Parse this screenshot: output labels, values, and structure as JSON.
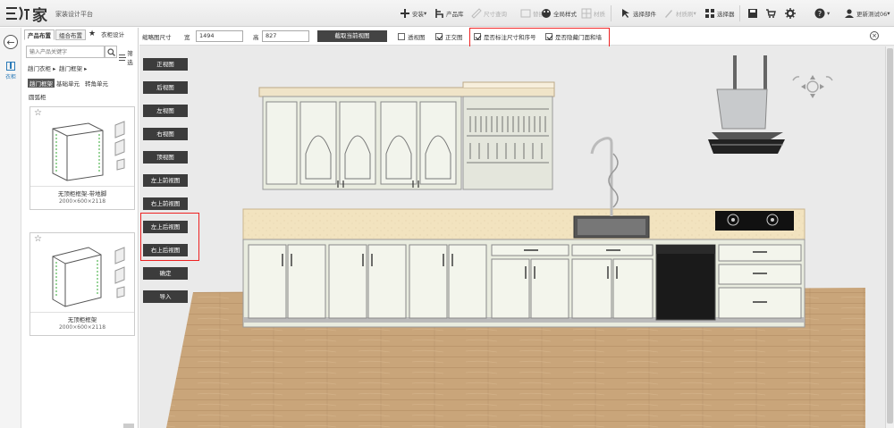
{
  "app": {
    "logo_text": "家",
    "platform_name": "家装设计平台"
  },
  "toolbar": {
    "install": "安装",
    "product_lib": "产品库",
    "size_query": "尺寸查询",
    "replace": "替换",
    "global_style": "全局样式",
    "material": "材质",
    "select_parts": "选择部件",
    "material_brush": "材质刷",
    "selector": "选择器",
    "user": "更新测试06"
  },
  "left": {
    "tabs": [
      "产品布置",
      "组合布置",
      "衣柜设计"
    ],
    "search_placeholder": "输入产品关键字",
    "filter_label": "筛选",
    "crumbs": [
      "趟门衣柜",
      "趟门框架"
    ],
    "subcats": [
      "趟门框架",
      "基础单元",
      "转角单元"
    ],
    "arc_cat": "圆弧柜",
    "rail_label": "衣柜",
    "products": [
      {
        "name": "无顶柜框架-带地脚",
        "dims": "2000×600×2118"
      },
      {
        "name": "无顶柜框架",
        "dims": "2000×600×2118"
      }
    ]
  },
  "options": {
    "thumb_size_label": "缩略图尺寸",
    "width_label": "宽",
    "width_value": "1494",
    "height_label": "高",
    "height_value": "827",
    "capture_btn": "截取当前视图",
    "perspective": "透视图",
    "perspective_checked": false,
    "orthographic": "正交图",
    "orthographic_checked": true,
    "show_dims": "是否标注尺寸和序号",
    "show_dims_checked": true,
    "hide_doors": "是否隐藏门面和墙",
    "hide_doors_checked": true
  },
  "views": {
    "front": "正视图",
    "back": "后视图",
    "left": "左视图",
    "right": "右视图",
    "top": "顶视图",
    "left_upper_front": "左上前视图",
    "right_upper_front": "右上前视图",
    "left_upper_back": "左上后视图",
    "right_upper_back": "右上后视图",
    "confirm": "确定",
    "export": "导入"
  },
  "colors": {
    "highlight": "#e22222",
    "button_dark": "#3c3c3c",
    "accent_blue": "#2a7ab8",
    "counter": "#f2e3bf",
    "cabinet": "#e9ecdf",
    "floor": "#c9a57a"
  }
}
